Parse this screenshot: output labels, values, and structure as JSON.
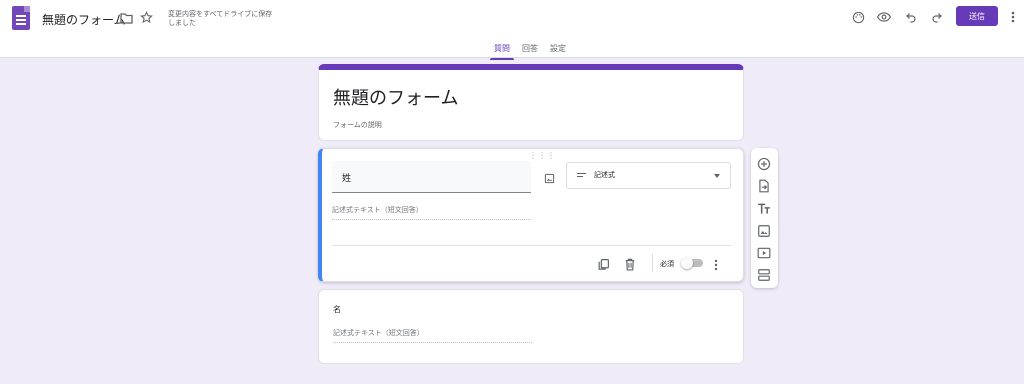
{
  "header": {
    "doc_title": "無題のフォーム",
    "save_status": "変更内容をすべてドライブに保存しました",
    "send_label": "送信",
    "icons": [
      "forms-logo-icon",
      "folder-icon",
      "star-icon",
      "palette-icon",
      "preview-eye-icon",
      "undo-icon",
      "redo-icon",
      "more-vert-icon"
    ]
  },
  "tabs": [
    {
      "label": "質問",
      "active": true
    },
    {
      "label": "回答",
      "active": false
    },
    {
      "label": "設定",
      "active": false
    }
  ],
  "form": {
    "title": "無題のフォーム",
    "description_placeholder": "フォームの説明"
  },
  "questions": [
    {
      "title": "姓",
      "type_label": "記述式",
      "answer_hint": "記述式テキスト（短文回答）",
      "required_label": "必須",
      "required": false
    },
    {
      "title": "名",
      "answer_hint": "記述式テキスト（短文回答）"
    }
  ],
  "side_toolbar": [
    "add-question-icon",
    "import-questions-icon",
    "add-title-icon",
    "add-image-icon",
    "add-video-icon",
    "add-section-icon"
  ],
  "colors": {
    "accent": "#673ab7",
    "background": "#f0ebf8",
    "active_border": "#4285f4"
  }
}
